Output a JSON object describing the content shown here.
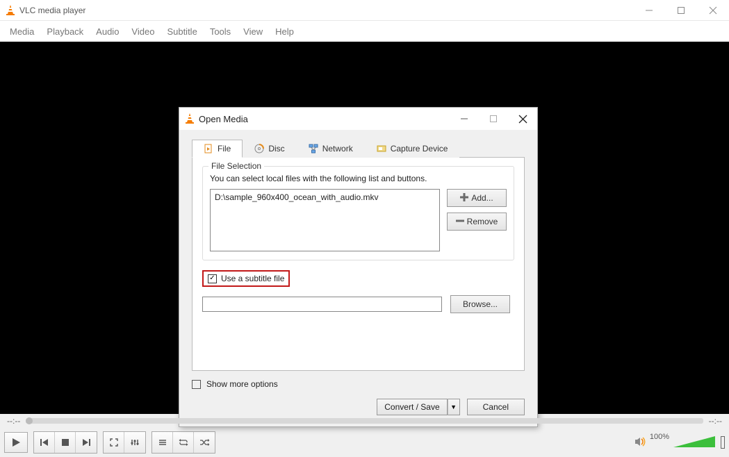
{
  "main_window": {
    "title": "VLC media player",
    "menu": [
      "Media",
      "Playback",
      "Audio",
      "Video",
      "Subtitle",
      "Tools",
      "View",
      "Help"
    ],
    "time_elapsed": "--:--",
    "time_total": "--:--",
    "volume_label": "100%"
  },
  "dialog": {
    "title": "Open Media",
    "tabs": [
      {
        "label": "File",
        "active": true
      },
      {
        "label": "Disc",
        "active": false
      },
      {
        "label": "Network",
        "active": false
      },
      {
        "label": "Capture Device",
        "active": false
      }
    ],
    "file_section": {
      "legend": "File Selection",
      "help": "You can select local files with the following list and buttons.",
      "files": [
        "D:\\sample_960x400_ocean_with_audio.mkv"
      ],
      "add_label": "Add...",
      "remove_label": "Remove"
    },
    "subtitle": {
      "checkbox_label": "Use a subtitle file",
      "checked": true,
      "path": "",
      "browse_label": "Browse..."
    },
    "show_more_label": "Show more options",
    "convert_label": "Convert / Save",
    "cancel_label": "Cancel"
  }
}
